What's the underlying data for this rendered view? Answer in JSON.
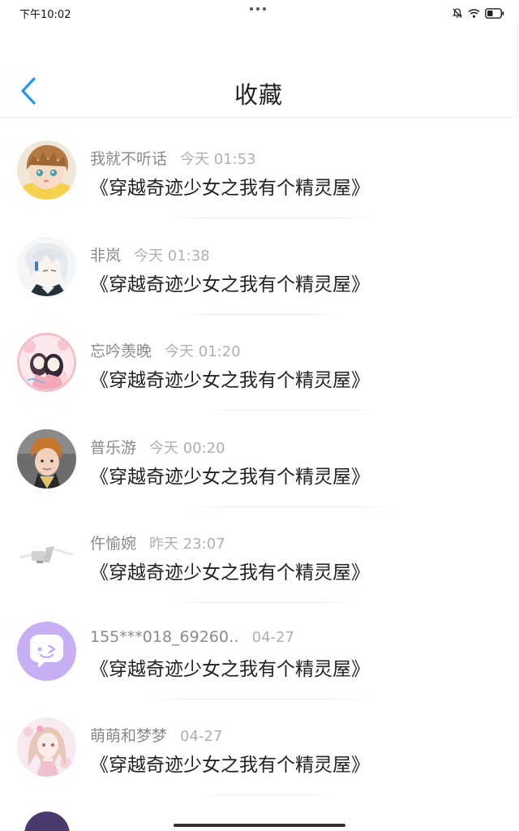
{
  "status_bar": {
    "time": "下午10:02",
    "icons": [
      "bell-off-icon",
      "wifi-icon",
      "battery-icon"
    ]
  },
  "header": {
    "title": "收藏",
    "back_icon": "chevron-left-icon",
    "accent_color": "#2196F3"
  },
  "favorites": [
    {
      "username": "我就不听话",
      "time": "今天 01:53",
      "book_title": "《穿越奇迹少女之我有个精灵屋》",
      "avatar": "avatar-brown-hair-kid"
    },
    {
      "username": "非岚",
      "time": "今天 01:38",
      "book_title": "《穿越奇迹少女之我有个精灵屋》",
      "avatar": "avatar-white-hair-anime"
    },
    {
      "username": "忘吟羡晚",
      "time": "今天 01:20",
      "book_title": "《穿越奇迹少女之我有个精灵屋》",
      "avatar": "avatar-pink-anime-couple"
    },
    {
      "username": "普乐游",
      "time": "今天 00:20",
      "book_title": "《穿越奇迹少女之我有个精灵屋》",
      "avatar": "avatar-boy-photo"
    },
    {
      "username": "仵愉婉",
      "time": "昨天 23:07",
      "book_title": "《穿越奇迹少女之我有个精灵屋》",
      "avatar": "avatar-gray-sketch"
    },
    {
      "username": "155***018_69260‥",
      "time": "04-27",
      "book_title": "《穿越奇迹少女之我有个精灵屋》",
      "avatar": "avatar-default-chat-bubble"
    },
    {
      "username": "萌萌和梦梦",
      "time": "04-27",
      "book_title": "《穿越奇迹少女之我有个精灵屋》",
      "avatar": "avatar-pink-anime-girl"
    }
  ]
}
